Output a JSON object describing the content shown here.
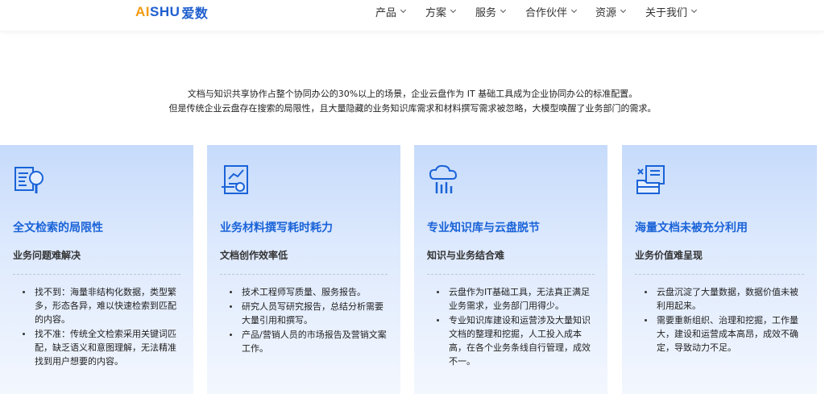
{
  "header": {
    "logo": {
      "ai": "AI",
      "shu": "SHU",
      "cn": "爱数"
    },
    "nav": [
      "产品",
      "方案",
      "服务",
      "合作伙伴",
      "资源",
      "关于我们"
    ]
  },
  "intro": {
    "line1": "文档与知识共享协作占整个协同办公的30%以上的场景，企业云盘作为 IT 基础工具成为企业协同办公的标准配置。",
    "line2": "但是传统企业云盘存在搜索的局限性，且大量隐藏的业务知识库需求和材料撰写需求被忽略，大模型唤醒了业务部门的需求。"
  },
  "cards": [
    {
      "icon": "document-search-icon",
      "title": "全文检索的局限性",
      "subtitle": "业务问题难解决",
      "items": [
        "找不到：海量非结构化数据，类型繁多，形态各异，难以快速检索到匹配的内容。",
        "找不准：传统全文检索采用关键词匹配，缺乏语义和意图理解，无法精准找到用户想要的内容。"
      ]
    },
    {
      "icon": "report-chart-icon",
      "title": "业务材料撰写耗时耗力",
      "subtitle": "文档创作效率低",
      "items": [
        "技术工程师写质量、服务报告。",
        "研究人员写研究报告，总结分析需要大量引用和撰写。",
        "产品/营销人员的市场报告及营销文案工作。"
      ]
    },
    {
      "icon": "cloud-data-icon",
      "title": "专业知识库与云盘脱节",
      "subtitle": "知识与业务结合难",
      "items": [
        "云盘作为IT基础工具，无法真正满足业务需求，业务部门用得少。",
        "专业知识库建设和运营涉及大量知识文档的整理和挖掘，人工投入成本高，在各个业务条线自行管理，成效不一。"
      ]
    },
    {
      "icon": "documents-folder-icon",
      "title": "海量文档未被充分利用",
      "subtitle": "业务价值难呈现",
      "items": [
        "云盘沉淀了大量数据，数据价值未被利用起来。",
        "需要重新组织、治理和挖掘，工作量大，建设和运营成本高昂，成效不确定，导致动力不足。"
      ]
    }
  ],
  "colors": {
    "accent": "#1a63d8",
    "logo_orange": "#f39c12",
    "card_top": "#c6dbfb"
  }
}
